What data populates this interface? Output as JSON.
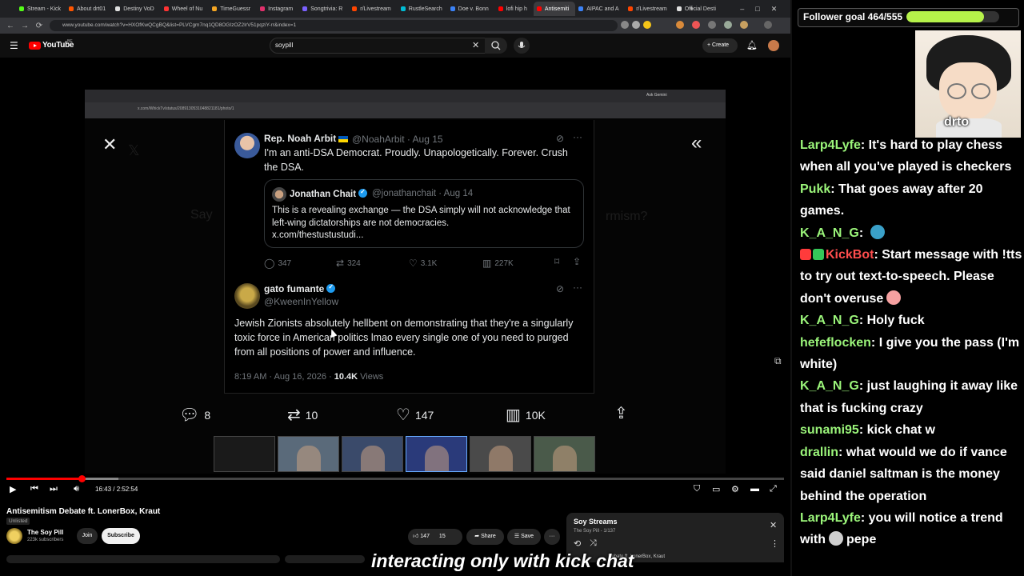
{
  "browser": {
    "tabs": [
      {
        "label": "Stream - Kick",
        "color": "#53fc18"
      },
      {
        "label": "About drt01",
        "color": "#ff5500"
      },
      {
        "label": "Destiny VoD",
        "color": "#e0e0e0"
      },
      {
        "label": "Wheel of Nu",
        "color": "#ff3333"
      },
      {
        "label": "TimeGuessr",
        "color": "#f5a623"
      },
      {
        "label": "Instagram",
        "color": "#e1306c"
      },
      {
        "label": "Songtrivia: R",
        "color": "#7b61ff"
      },
      {
        "label": "r/Livestream",
        "color": "#ff4500"
      },
      {
        "label": "RustleSearch",
        "color": "#00bcd4"
      },
      {
        "label": "Doe v. Bonn",
        "color": "#3b82f6"
      },
      {
        "label": "lofi hip h",
        "color": "#ff0000"
      },
      {
        "label": "Antisemiti",
        "color": "#ff0000",
        "active": true
      },
      {
        "label": "AIPAC and A",
        "color": "#3b82f6"
      },
      {
        "label": "r/Livestream",
        "color": "#ff4500"
      },
      {
        "label": "Official Desti",
        "color": "#e0e0e0"
      }
    ],
    "new_tab": "+",
    "controls": {
      "minimize": "–",
      "maximize": "□",
      "close": "✕"
    },
    "url": "www.youtube.com/watch?v=HXOfKwQCgBQ&list=PLVCgm7nq1QD8OGIzOZ2IrV51pqziY-rr&index=1",
    "nav": {
      "back": "←",
      "forward": "→",
      "reload": "⟳"
    }
  },
  "youtube": {
    "logo_text": "YouTube",
    "logo_sup": "BE",
    "search_value": "soypill",
    "create_label": "Create",
    "video": {
      "inner_url": "x.com/WhickTv/status/2089130531048821181/photo/1",
      "inner_tab_label": "Ask Gemini",
      "tweet1": {
        "name": "Rep. Noah Arbit",
        "handle_date": "@NoahArbit · Aug 15",
        "body": "I'm an anti-DSA Democrat. Proudly. Unapologetically. Forever. Crush the DSA.",
        "quote_name": "Jonathan Chait",
        "quote_handle_date": "@jonathanchait · Aug 14",
        "quote_body": "This is a revealing exchange — the DSA simply will not acknowledge that left-wing dictatorships are not democracies.",
        "quote_link": "x.com/thestustustudi...",
        "replies": "347",
        "reposts": "324",
        "likes": "3.1K",
        "views": "227K"
      },
      "tweet2": {
        "name": "gato fumante",
        "handle": "@KweenInYellow",
        "body": "Jewish Zionists absolutely hellbent on demonstrating that they're a singularly toxic force in American politics lmao every single one of you need to purged from all positions of power and influence.",
        "time": "8:19 AM · Aug 16, 2026 · ",
        "views_count": "10.4K",
        "views_word": " Views",
        "replies": "8",
        "reposts": "10",
        "likes": "147",
        "views": "10K"
      },
      "ghost_text": "Say",
      "ghost_text2": "rmism?"
    },
    "player": {
      "time": "16:43 / 2:52:54",
      "progress": 0.097
    },
    "below": {
      "title": "Antisemitism Debate ft. LonerBox, Kraut",
      "unlisted": "Unlisted",
      "channel": "The Soy Pill",
      "subs": "223k subscribers",
      "join": "Join",
      "subscribe": "Subscribe",
      "likes": "147",
      "dislikes": "15",
      "share": "Share",
      "save": "Save"
    },
    "playlist": {
      "title": "Soy Streams",
      "sub": "The Soy Pill - 1/137",
      "next": "Debate ft. LonerBox, Kraut"
    }
  },
  "overlay": {
    "goal_text": "Follower goal 464/555",
    "goal_value": 464,
    "goal_max": 555,
    "cam_name": "drto",
    "caption": "interacting only with kick chat"
  },
  "chat": {
    "messages": [
      {
        "user": "Larp4Lyfe",
        "color": "#9bf57a",
        "text": "It's hard to play chess when all you've played is checkers"
      },
      {
        "user": "Pukk",
        "color": "#9bf57a",
        "text": "That goes away after 20 games."
      },
      {
        "user": "K_A_N_G",
        "color": "#9bf57a",
        "text": "",
        "emote": "#3aa0c8"
      },
      {
        "user": "KickBot",
        "color": "#ff4d4d",
        "text": "Start message with !tts to try out text-to-speech. Please don't overuse",
        "emote": "#f5a0a0",
        "badges": [
          "#ff3b3b",
          "#35c759"
        ]
      },
      {
        "user": "K_A_N_G",
        "color": "#9bf57a",
        "text": "Holy fuck"
      },
      {
        "user": "hefeflocken",
        "color": "#9bf57a",
        "text": "I give you the pass (I'm white)"
      },
      {
        "user": "K_A_N_G",
        "color": "#9bf57a",
        "text": "just laughing it away like that is fucking crazy"
      },
      {
        "user": "sunami95",
        "color": "#9bf57a",
        "text": "kick chat w"
      },
      {
        "user": "drallin",
        "color": "#9bf57a",
        "text": "what would we do if vance said daniel saltman is the money behind the operation"
      },
      {
        "user": "Larp4Lyfe",
        "color": "#9bf57a",
        "text": "you will notice a trend with",
        "emote": "#cfcfcf",
        "tail": "pepe"
      }
    ]
  }
}
